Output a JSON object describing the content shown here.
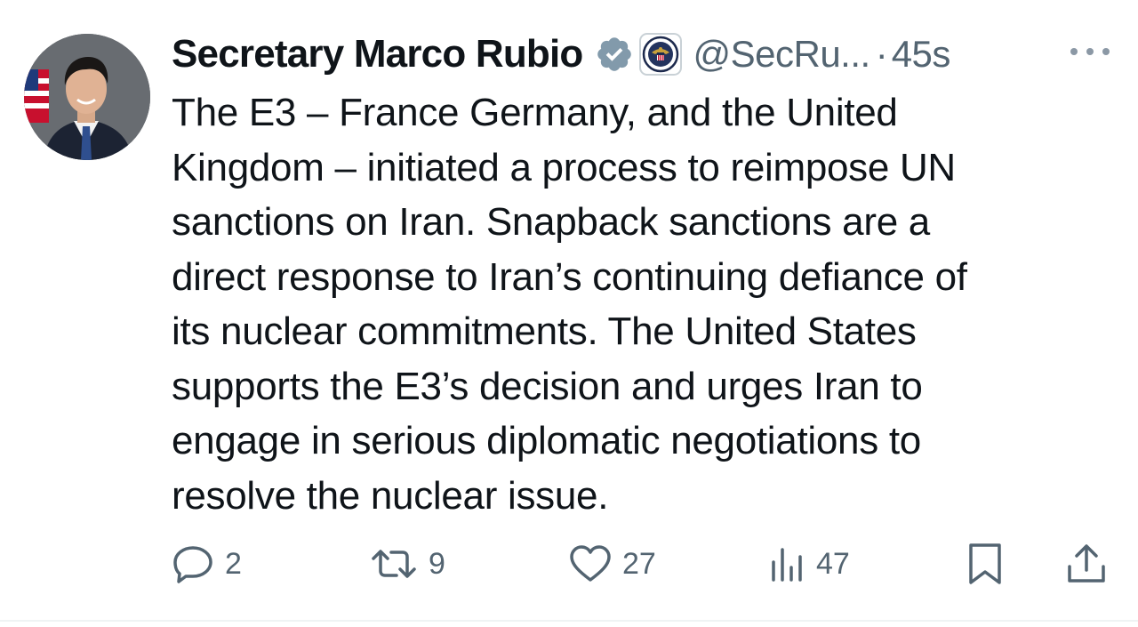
{
  "author": {
    "display_name": "Secretary Marco Rubio",
    "handle": "@SecRu...",
    "separator": "·",
    "timestamp": "45s",
    "avatar_icon": "avatar-photo",
    "verified_icon": "verified-badge-icon",
    "affiliation_icon": "state-department-seal-icon"
  },
  "tweet": {
    "lines": [
      "The E3 – France Germany, and the United",
      "Kingdom – initiated a process to reimpose UN",
      "sanctions on Iran. Snapback sanctions are a",
      "direct response to Iran’s continuing defiance of",
      "its nuclear commitments. The United States",
      "supports the E3’s decision and urges Iran to",
      "engage in serious diplomatic negotiations to",
      "resolve the nuclear issue."
    ]
  },
  "actions": {
    "reply": {
      "icon": "reply-icon",
      "count": "2"
    },
    "repost": {
      "icon": "repost-icon",
      "count": "9"
    },
    "like": {
      "icon": "heart-icon",
      "count": "27"
    },
    "views": {
      "icon": "views-icon",
      "count": "47"
    },
    "bookmark": {
      "icon": "bookmark-icon"
    },
    "share": {
      "icon": "share-icon"
    }
  },
  "colors": {
    "text_primary": "#0f1419",
    "text_secondary": "#536471",
    "verified_badge": "#829aab",
    "background": "#ffffff"
  }
}
